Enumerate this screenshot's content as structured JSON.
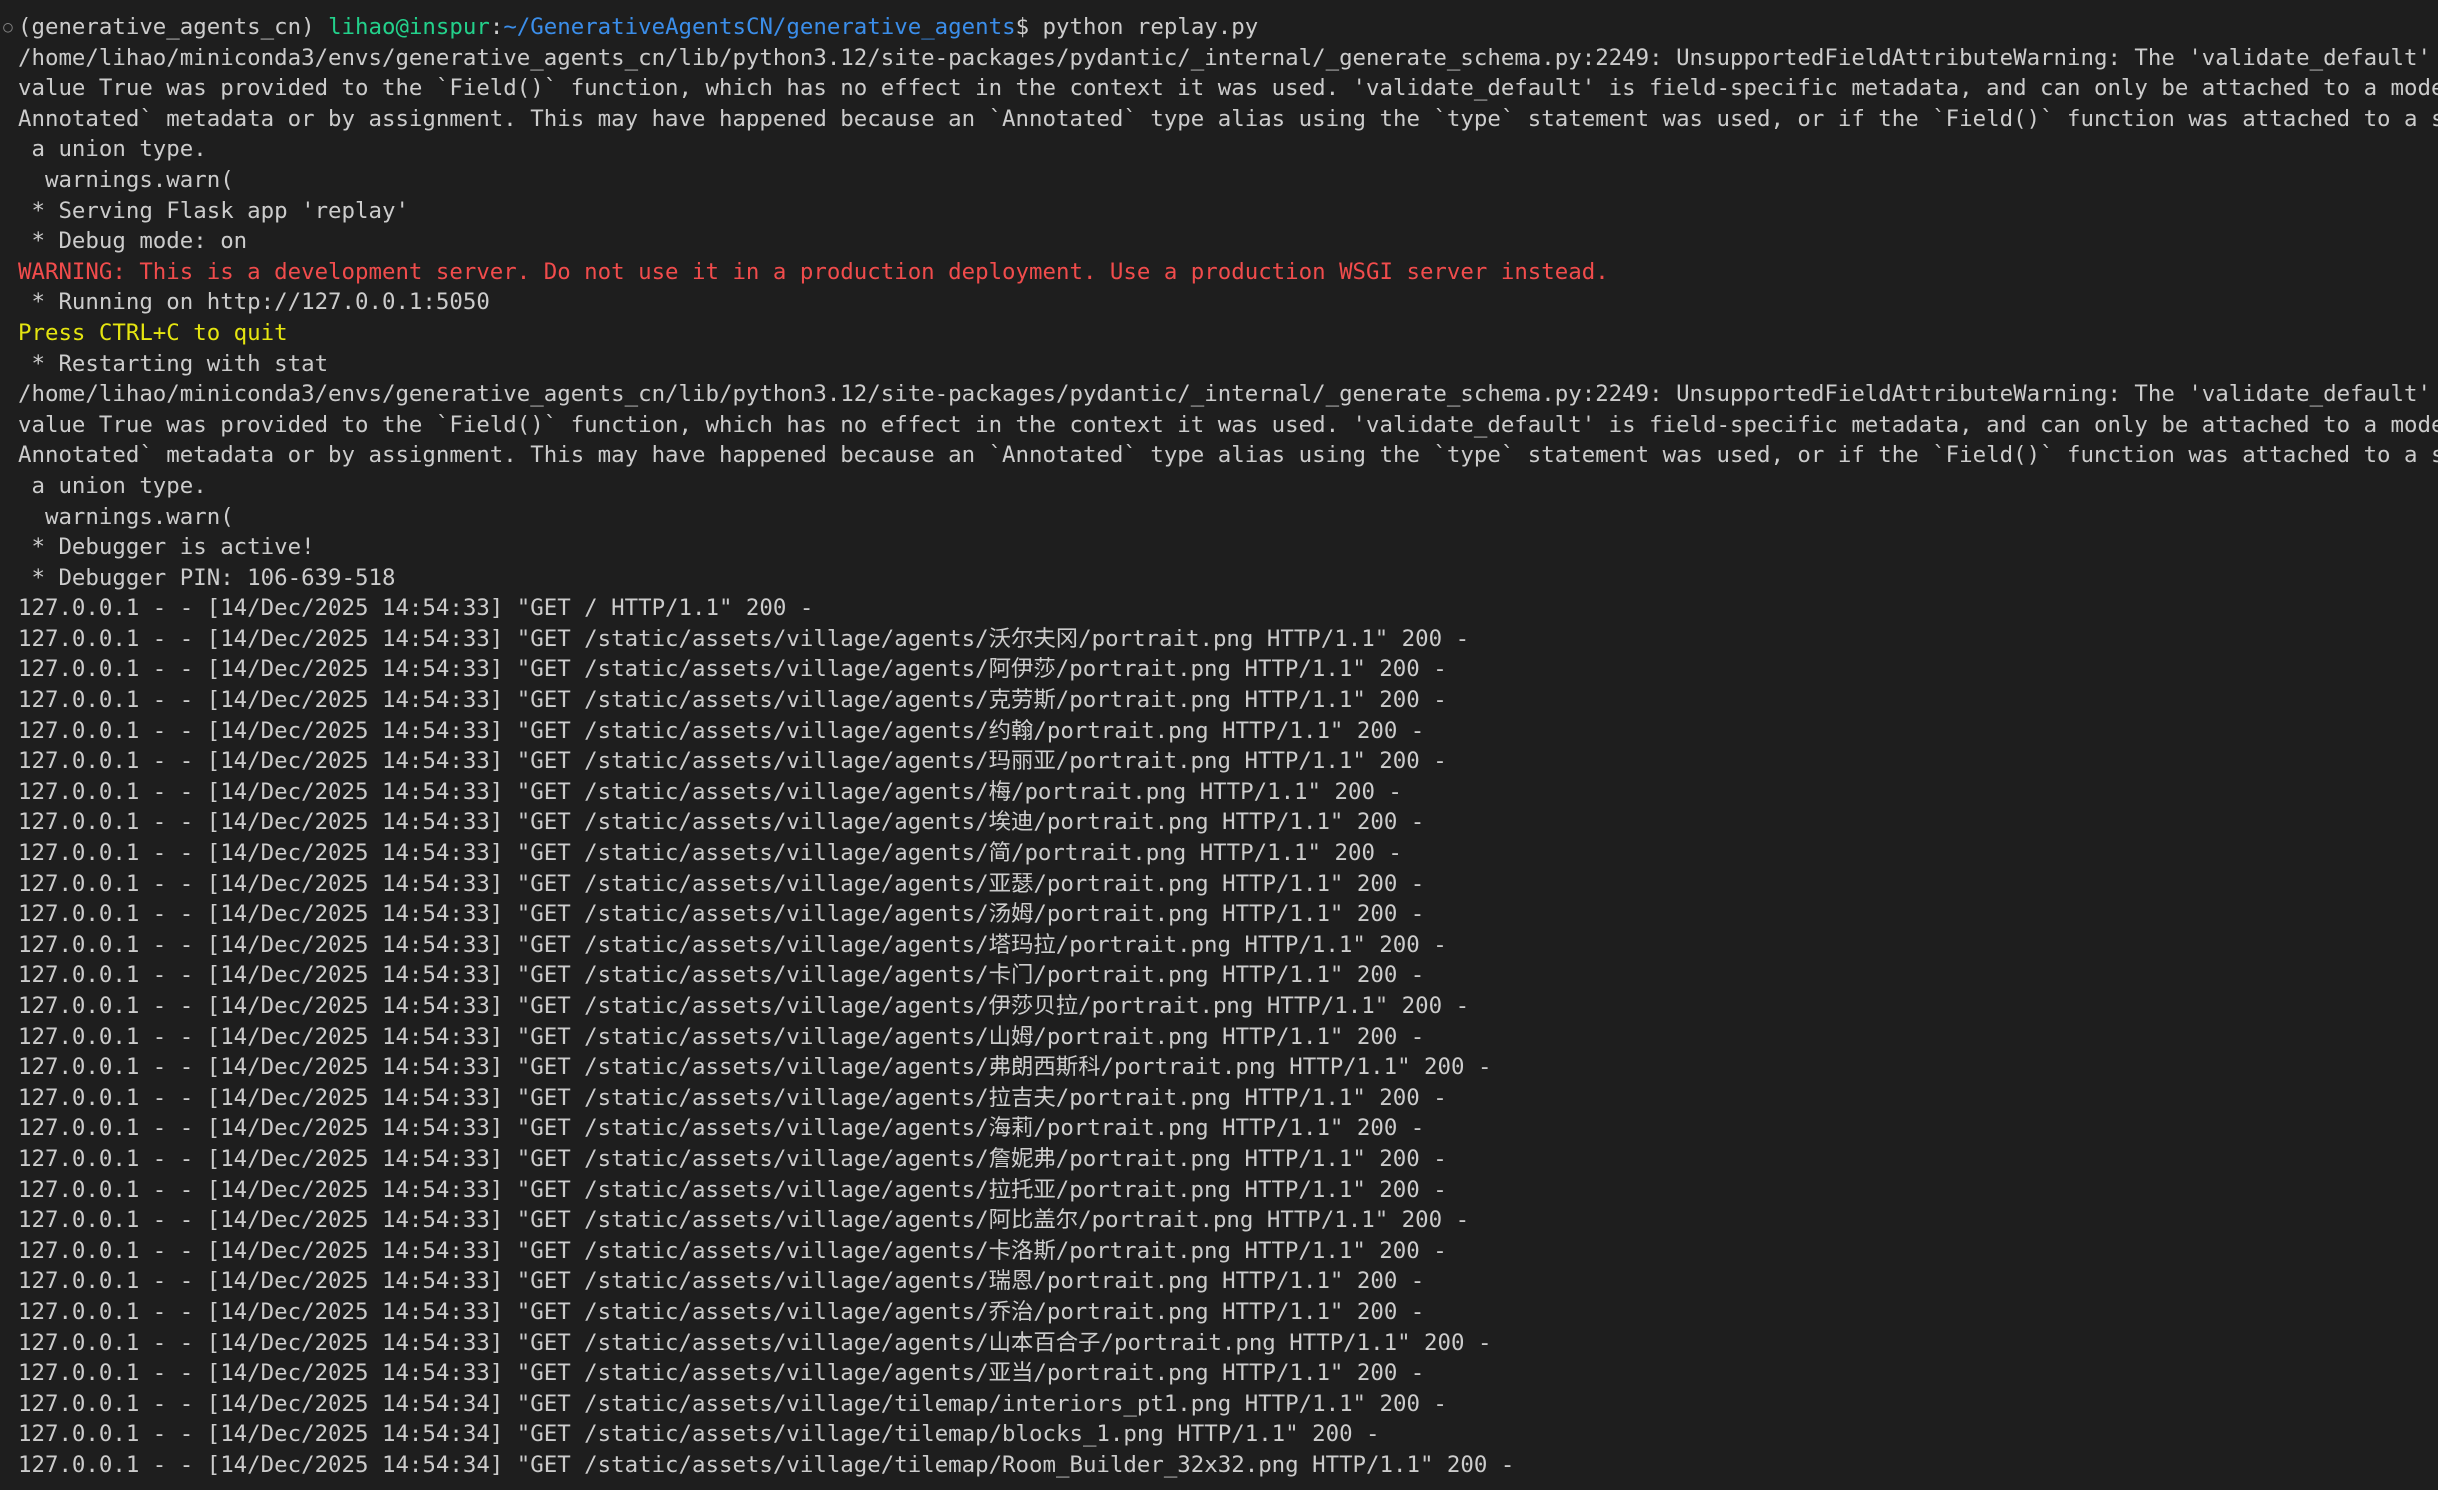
{
  "terminal": {
    "gutter_symbol": "○",
    "prompt": {
      "env": "(generative_agents_cn) ",
      "user_host": "lihao@inspur",
      "colon": ":",
      "path": "~/GenerativeAgentsCN/generative_agents",
      "dollar": "$ ",
      "command": "python replay.py"
    },
    "colors": {
      "background": "#1e1e1e",
      "foreground": "#cccccc",
      "user_host": "#23d18b",
      "path": "#3b8eea",
      "warning": "#f14c4c",
      "hint": "#e5e510"
    },
    "lines": [
      "/home/lihao/miniconda3/envs/generative_agents_cn/lib/python3.12/site-packages/pydantic/_internal/_generate_schema.py:2249: UnsupportedFieldAttributeWarning: The 'validate_default' attribute wi",
      "value True was provided to the `Field()` function, which has no effect in the context it was used. 'validate_default' is field-specific metadata, and can only be attached to a model field usin",
      "Annotated` metadata or by assignment. This may have happened because an `Annotated` type alias using the `type` statement was used, or if the `Field()` function was attached to a single member",
      " a union type.",
      "  warnings.warn(",
      " * Serving Flask app 'replay'",
      " * Debug mode: on",
      "WARNING: This is a development server. Do not use it in a production deployment. Use a production WSGI server instead.",
      " * Running on http://127.0.0.1:5050",
      "Press CTRL+C to quit",
      " * Restarting with stat",
      "/home/lihao/miniconda3/envs/generative_agents_cn/lib/python3.12/site-packages/pydantic/_internal/_generate_schema.py:2249: UnsupportedFieldAttributeWarning: The 'validate_default' attribute wi",
      "value True was provided to the `Field()` function, which has no effect in the context it was used. 'validate_default' is field-specific metadata, and can only be attached to a model field usin",
      "Annotated` metadata or by assignment. This may have happened because an `Annotated` type alias using the `type` statement was used, or if the `Field()` function was attached to a single member",
      " a union type.",
      "  warnings.warn(",
      " * Debugger is active!",
      " * Debugger PIN: 106-639-518",
      "127.0.0.1 - - [14/Dec/2025 14:54:33] \"GET / HTTP/1.1\" 200 -",
      "127.0.0.1 - - [14/Dec/2025 14:54:33] \"GET /static/assets/village/agents/沃尔夫冈/portrait.png HTTP/1.1\" 200 -",
      "127.0.0.1 - - [14/Dec/2025 14:54:33] \"GET /static/assets/village/agents/阿伊莎/portrait.png HTTP/1.1\" 200 -",
      "127.0.0.1 - - [14/Dec/2025 14:54:33] \"GET /static/assets/village/agents/克劳斯/portrait.png HTTP/1.1\" 200 -",
      "127.0.0.1 - - [14/Dec/2025 14:54:33] \"GET /static/assets/village/agents/约翰/portrait.png HTTP/1.1\" 200 -",
      "127.0.0.1 - - [14/Dec/2025 14:54:33] \"GET /static/assets/village/agents/玛丽亚/portrait.png HTTP/1.1\" 200 -",
      "127.0.0.1 - - [14/Dec/2025 14:54:33] \"GET /static/assets/village/agents/梅/portrait.png HTTP/1.1\" 200 -",
      "127.0.0.1 - - [14/Dec/2025 14:54:33] \"GET /static/assets/village/agents/埃迪/portrait.png HTTP/1.1\" 200 -",
      "127.0.0.1 - - [14/Dec/2025 14:54:33] \"GET /static/assets/village/agents/简/portrait.png HTTP/1.1\" 200 -",
      "127.0.0.1 - - [14/Dec/2025 14:54:33] \"GET /static/assets/village/agents/亚瑟/portrait.png HTTP/1.1\" 200 -",
      "127.0.0.1 - - [14/Dec/2025 14:54:33] \"GET /static/assets/village/agents/汤姆/portrait.png HTTP/1.1\" 200 -",
      "127.0.0.1 - - [14/Dec/2025 14:54:33] \"GET /static/assets/village/agents/塔玛拉/portrait.png HTTP/1.1\" 200 -",
      "127.0.0.1 - - [14/Dec/2025 14:54:33] \"GET /static/assets/village/agents/卡门/portrait.png HTTP/1.1\" 200 -",
      "127.0.0.1 - - [14/Dec/2025 14:54:33] \"GET /static/assets/village/agents/伊莎贝拉/portrait.png HTTP/1.1\" 200 -",
      "127.0.0.1 - - [14/Dec/2025 14:54:33] \"GET /static/assets/village/agents/山姆/portrait.png HTTP/1.1\" 200 -",
      "127.0.0.1 - - [14/Dec/2025 14:54:33] \"GET /static/assets/village/agents/弗朗西斯科/portrait.png HTTP/1.1\" 200 -",
      "127.0.0.1 - - [14/Dec/2025 14:54:33] \"GET /static/assets/village/agents/拉吉夫/portrait.png HTTP/1.1\" 200 -",
      "127.0.0.1 - - [14/Dec/2025 14:54:33] \"GET /static/assets/village/agents/海莉/portrait.png HTTP/1.1\" 200 -",
      "127.0.0.1 - - [14/Dec/2025 14:54:33] \"GET /static/assets/village/agents/詹妮弗/portrait.png HTTP/1.1\" 200 -",
      "127.0.0.1 - - [14/Dec/2025 14:54:33] \"GET /static/assets/village/agents/拉托亚/portrait.png HTTP/1.1\" 200 -",
      "127.0.0.1 - - [14/Dec/2025 14:54:33] \"GET /static/assets/village/agents/阿比盖尔/portrait.png HTTP/1.1\" 200 -",
      "127.0.0.1 - - [14/Dec/2025 14:54:33] \"GET /static/assets/village/agents/卡洛斯/portrait.png HTTP/1.1\" 200 -",
      "127.0.0.1 - - [14/Dec/2025 14:54:33] \"GET /static/assets/village/agents/瑞恩/portrait.png HTTP/1.1\" 200 -",
      "127.0.0.1 - - [14/Dec/2025 14:54:33] \"GET /static/assets/village/agents/乔治/portrait.png HTTP/1.1\" 200 -",
      "127.0.0.1 - - [14/Dec/2025 14:54:33] \"GET /static/assets/village/agents/山本百合子/portrait.png HTTP/1.1\" 200 -",
      "127.0.0.1 - - [14/Dec/2025 14:54:33] \"GET /static/assets/village/agents/亚当/portrait.png HTTP/1.1\" 200 -",
      "127.0.0.1 - - [14/Dec/2025 14:54:34] \"GET /static/assets/village/tilemap/interiors_pt1.png HTTP/1.1\" 200 -",
      "127.0.0.1 - - [14/Dec/2025 14:54:34] \"GET /static/assets/village/tilemap/blocks_1.png HTTP/1.1\" 200 -",
      "127.0.0.1 - - [14/Dec/2025 14:54:34] \"GET /static/assets/village/tilemap/Room_Builder_32x32.png HTTP/1.1\" 200 -"
    ]
  }
}
